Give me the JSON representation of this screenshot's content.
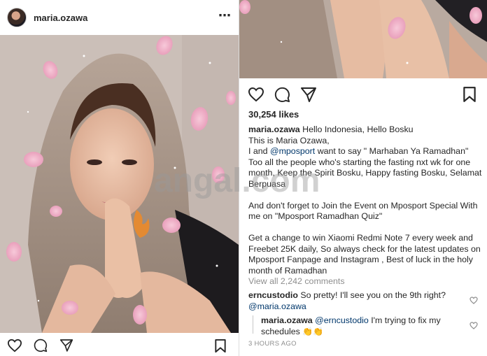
{
  "post": {
    "username": "maria.ozawa",
    "more_icon": "⋯"
  },
  "engagement": {
    "likes": "30,254 likes",
    "view_all": "View all 2,242 comments"
  },
  "caption": {
    "username": "maria.ozawa",
    "line1": "Hello Indonesia, Hello Bosku",
    "line2": "This is Maria Ozawa,",
    "line3_a": "I and ",
    "line3_mention": "@mposport",
    "line3_b": " want to say \" Marhaban Ya Ramadhan\" Too all the people who's starting the fasting nxt wk for one month, Keep the Spirit Bosku, Happy fasting Bosku, Selamat Berpuasa",
    "para2": "And don't forget to Join the Event on Mposport Special With me on \"Mposport Ramadhan Quiz\"",
    "para3": "Get a change to win Xiaomi Redmi Note 7 every week and Freebet 25K daily, So always check for the latest updates on Mposport Fanpage and Instagram , Best of luck in the holy month of Ramadhan"
  },
  "comments": [
    {
      "username": "erncustodio",
      "text": "So pretty! I'll see you on the 9th right?",
      "mention": "@maria.ozawa"
    }
  ],
  "reply": {
    "username": "maria.ozawa",
    "mention": "@erncustodio",
    "text": " I'm trying to fix my schedules ",
    "emoji": "👏👏",
    "time": "3 HOURS AGO"
  },
  "watermark_text": "angal.com",
  "icons": [
    "heart-icon",
    "comment-icon",
    "share-icon",
    "bookmark-icon",
    "more-icon",
    "avatar"
  ],
  "colors": {
    "mention": "#00376b",
    "muted": "#8e8e8e",
    "text": "#262626"
  }
}
